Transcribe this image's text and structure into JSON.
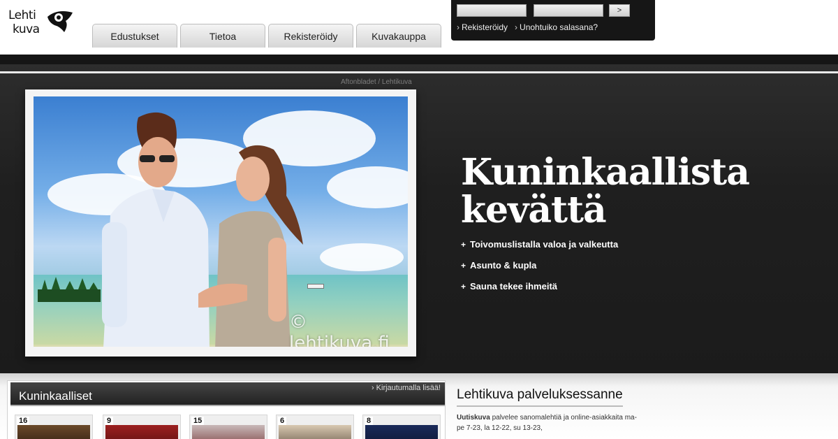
{
  "brand": {
    "logo_line1": "Lehti",
    "logo_line2": "kuva"
  },
  "tabs": [
    {
      "label": "Edustukset"
    },
    {
      "label": "Tietoa"
    },
    {
      "label": "Rekisteröidy"
    },
    {
      "label": "Kuvakauppa"
    }
  ],
  "login": {
    "username_value": "",
    "password_value": "",
    "submit_label": ">",
    "register_label": "Rekisteröidy",
    "forgot_label": "Unohtuiko salasana?"
  },
  "hero": {
    "photo_credit": "Aftonbladet / Lehtikuva",
    "watermark": "© lehtikuva.fi",
    "headline_line1": "Kuninkaallista",
    "headline_line2": "kevättä",
    "bullets": [
      "Toivomuslistalla valoa ja valkeutta",
      "Asunto & kupla",
      "Sauna tekee ihmeitä"
    ]
  },
  "royals": {
    "title": "Kuninkaalliset",
    "more_label": "Kirjautumalla lisää!",
    "thumbs": [
      {
        "count": "16"
      },
      {
        "count": "9"
      },
      {
        "count": "15"
      },
      {
        "count": "6"
      },
      {
        "count": "8"
      }
    ]
  },
  "service": {
    "title": "Lehtikuva palveluksessanne",
    "text_bold": "Uutiskuva",
    "text_line1": "palvelee sanomalehtiä ja online-asiakkaita ma-",
    "text_line2": "pe 7-23, la 12-22, su 13-23,"
  },
  "colors": {
    "hero_bg": "#1f1f1f",
    "tab_bg": "#dcdcdc",
    "login_bg": "#161616"
  }
}
